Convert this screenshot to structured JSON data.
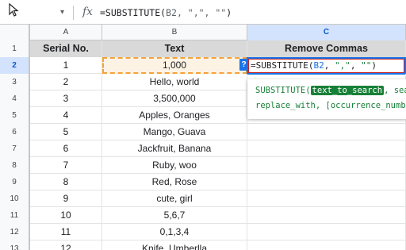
{
  "formula_bar": {
    "fx_label": "fx",
    "formula_prefix": "=SUBSTITUTE(",
    "formula_args": "B2, \",\", \"\"",
    "formula_suffix": ")"
  },
  "columns": [
    "A",
    "B",
    "C"
  ],
  "header_row": {
    "row_num": "1",
    "serial": "Serial No.",
    "text": "Text",
    "remove": "Remove Commas"
  },
  "rows": [
    {
      "num": "2",
      "serial": "1",
      "text": "1,000"
    },
    {
      "num": "3",
      "serial": "2",
      "text": "Hello, world"
    },
    {
      "num": "4",
      "serial": "3",
      "text": "3,500,000"
    },
    {
      "num": "5",
      "serial": "4",
      "text": "Apples, Oranges"
    },
    {
      "num": "6",
      "serial": "5",
      "text": "Mango, Guava"
    },
    {
      "num": "7",
      "serial": "6",
      "text": "Jackfruit, Banana"
    },
    {
      "num": "8",
      "serial": "7",
      "text": "Ruby, woo"
    },
    {
      "num": "9",
      "serial": "8",
      "text": "Red, Rose"
    },
    {
      "num": "10",
      "serial": "9",
      "text": "cute, girl"
    },
    {
      "num": "11",
      "serial": "10",
      "text": "5,6,7"
    },
    {
      "num": "12",
      "serial": "11",
      "text": "0,1,3,4"
    },
    {
      "num": "13",
      "serial": "12",
      "text": "Knife, Umberlla"
    }
  ],
  "editor": {
    "prefix": "=SUBSTITUTE(",
    "ref": "B2",
    "sep1": ", ",
    "str1": "\",\"",
    "sep2": ", ",
    "str2": "\"\"",
    "suffix": ")"
  },
  "help_badge": "?",
  "hint": {
    "fn": "SUBSTITUTE(",
    "arg1": "text_to_search",
    "rest1": ", sea",
    "line2": "replace_with, [occurrence_numbe"
  },
  "colors": {
    "selection_blue": "#1a73e8",
    "copy_dash": "#f4a239",
    "hint_green": "#188038"
  }
}
